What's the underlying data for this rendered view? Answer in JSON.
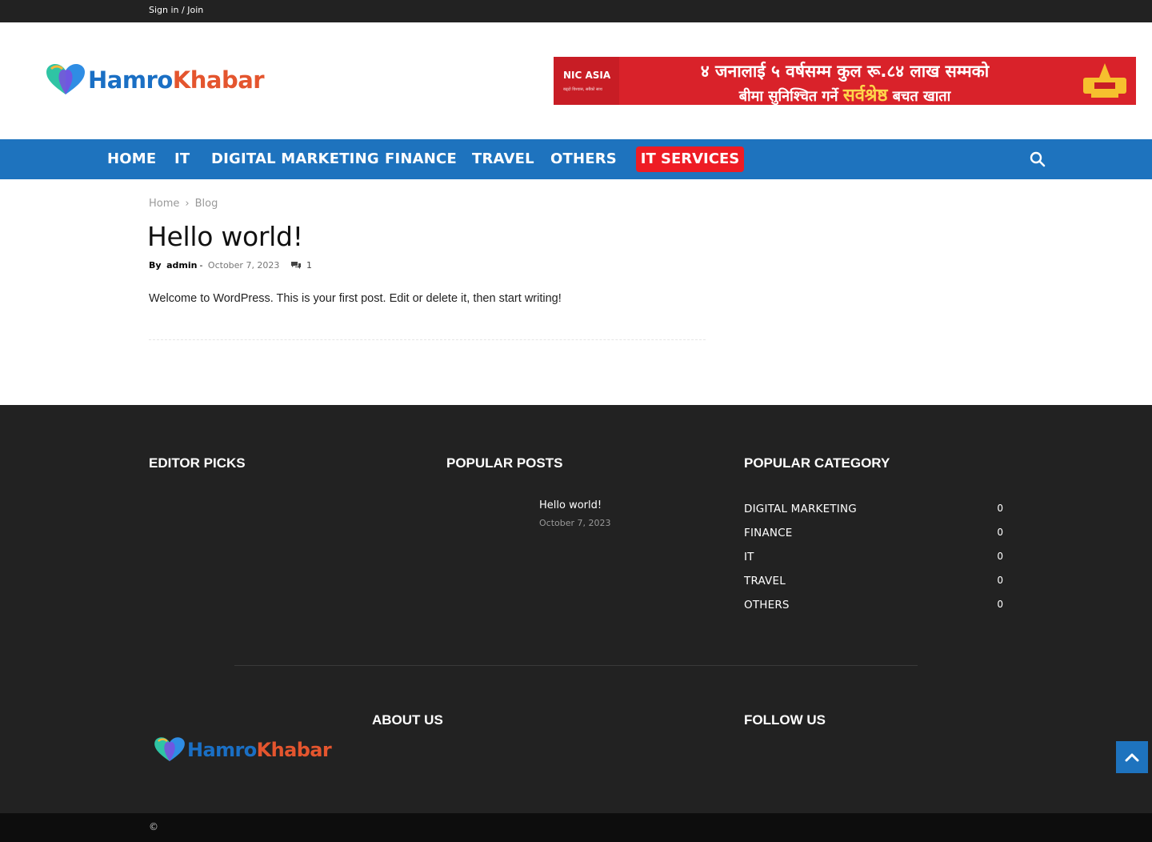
{
  "topbar": {
    "signin_label": "Sign in / Join"
  },
  "header": {
    "logo_part1": "Hamro",
    "logo_part2": "Khabar",
    "ad": {
      "bank_name": "NIC ASIA",
      "bank_tagline": "बढ्दो विश्वास, सबैको साथ",
      "line1": "४ जनालाई ५ वर्षसम्म कुल रू.८४ लाख सम्मको",
      "line2_pre": "बीमा सुनिश्चित गर्ने ",
      "line2_highlight": "सर्वश्रेष्ठ",
      "line2_post": " बचत खाता"
    }
  },
  "nav": {
    "items": [
      "HOME",
      "IT",
      "DIGITAL MARKETING",
      "FINANCE",
      "TRAVEL",
      "OTHERS"
    ],
    "highlight_item": "IT SERVICES",
    "accent_color": "#1e73be",
    "highlight_color": "#ee1c24"
  },
  "breadcrumb": {
    "items": [
      "Home",
      "Blog"
    ],
    "separator": "›"
  },
  "post": {
    "title": "Hello world!",
    "by_label": "By",
    "author": "admin",
    "date": "October 7, 2023",
    "comment_count": "1",
    "body": "Welcome to WordPress. This is your first post. Edit or delete it, then start writing!"
  },
  "footer": {
    "editor_picks_heading": "EDITOR PICKS",
    "popular_posts_heading": "POPULAR POSTS",
    "popular_posts": [
      {
        "title": "Hello world!",
        "date": "October 7, 2023"
      }
    ],
    "popular_category_heading": "POPULAR CATEGORY",
    "categories": [
      {
        "name": "DIGITAL MARKETING",
        "count": "0"
      },
      {
        "name": "FINANCE",
        "count": "0"
      },
      {
        "name": "IT",
        "count": "0"
      },
      {
        "name": "TRAVEL",
        "count": "0"
      },
      {
        "name": "OTHERS",
        "count": "0"
      }
    ],
    "about_heading": "ABOUT US",
    "follow_heading": "FOLLOW US",
    "copyright": "©"
  }
}
